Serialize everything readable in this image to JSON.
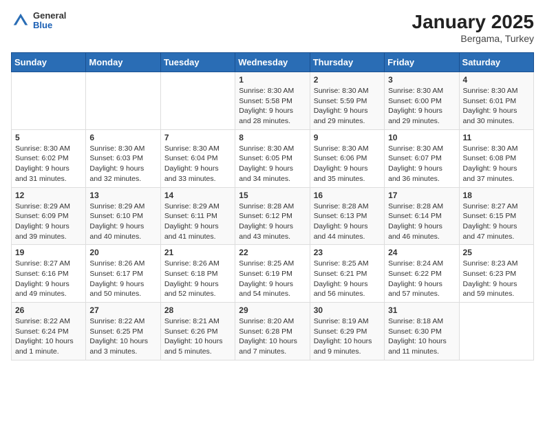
{
  "logo": {
    "general": "General",
    "blue": "Blue"
  },
  "title": "January 2025",
  "subtitle": "Bergama, Turkey",
  "weekdays": [
    "Sunday",
    "Monday",
    "Tuesday",
    "Wednesday",
    "Thursday",
    "Friday",
    "Saturday"
  ],
  "weeks": [
    [
      {
        "day": "",
        "info": ""
      },
      {
        "day": "",
        "info": ""
      },
      {
        "day": "",
        "info": ""
      },
      {
        "day": "1",
        "info": "Sunrise: 8:30 AM\nSunset: 5:58 PM\nDaylight: 9 hours and 28 minutes."
      },
      {
        "day": "2",
        "info": "Sunrise: 8:30 AM\nSunset: 5:59 PM\nDaylight: 9 hours and 29 minutes."
      },
      {
        "day": "3",
        "info": "Sunrise: 8:30 AM\nSunset: 6:00 PM\nDaylight: 9 hours and 29 minutes."
      },
      {
        "day": "4",
        "info": "Sunrise: 8:30 AM\nSunset: 6:01 PM\nDaylight: 9 hours and 30 minutes."
      }
    ],
    [
      {
        "day": "5",
        "info": "Sunrise: 8:30 AM\nSunset: 6:02 PM\nDaylight: 9 hours and 31 minutes."
      },
      {
        "day": "6",
        "info": "Sunrise: 8:30 AM\nSunset: 6:03 PM\nDaylight: 9 hours and 32 minutes."
      },
      {
        "day": "7",
        "info": "Sunrise: 8:30 AM\nSunset: 6:04 PM\nDaylight: 9 hours and 33 minutes."
      },
      {
        "day": "8",
        "info": "Sunrise: 8:30 AM\nSunset: 6:05 PM\nDaylight: 9 hours and 34 minutes."
      },
      {
        "day": "9",
        "info": "Sunrise: 8:30 AM\nSunset: 6:06 PM\nDaylight: 9 hours and 35 minutes."
      },
      {
        "day": "10",
        "info": "Sunrise: 8:30 AM\nSunset: 6:07 PM\nDaylight: 9 hours and 36 minutes."
      },
      {
        "day": "11",
        "info": "Sunrise: 8:30 AM\nSunset: 6:08 PM\nDaylight: 9 hours and 37 minutes."
      }
    ],
    [
      {
        "day": "12",
        "info": "Sunrise: 8:29 AM\nSunset: 6:09 PM\nDaylight: 9 hours and 39 minutes."
      },
      {
        "day": "13",
        "info": "Sunrise: 8:29 AM\nSunset: 6:10 PM\nDaylight: 9 hours and 40 minutes."
      },
      {
        "day": "14",
        "info": "Sunrise: 8:29 AM\nSunset: 6:11 PM\nDaylight: 9 hours and 41 minutes."
      },
      {
        "day": "15",
        "info": "Sunrise: 8:28 AM\nSunset: 6:12 PM\nDaylight: 9 hours and 43 minutes."
      },
      {
        "day": "16",
        "info": "Sunrise: 8:28 AM\nSunset: 6:13 PM\nDaylight: 9 hours and 44 minutes."
      },
      {
        "day": "17",
        "info": "Sunrise: 8:28 AM\nSunset: 6:14 PM\nDaylight: 9 hours and 46 minutes."
      },
      {
        "day": "18",
        "info": "Sunrise: 8:27 AM\nSunset: 6:15 PM\nDaylight: 9 hours and 47 minutes."
      }
    ],
    [
      {
        "day": "19",
        "info": "Sunrise: 8:27 AM\nSunset: 6:16 PM\nDaylight: 9 hours and 49 minutes."
      },
      {
        "day": "20",
        "info": "Sunrise: 8:26 AM\nSunset: 6:17 PM\nDaylight: 9 hours and 50 minutes."
      },
      {
        "day": "21",
        "info": "Sunrise: 8:26 AM\nSunset: 6:18 PM\nDaylight: 9 hours and 52 minutes."
      },
      {
        "day": "22",
        "info": "Sunrise: 8:25 AM\nSunset: 6:19 PM\nDaylight: 9 hours and 54 minutes."
      },
      {
        "day": "23",
        "info": "Sunrise: 8:25 AM\nSunset: 6:21 PM\nDaylight: 9 hours and 56 minutes."
      },
      {
        "day": "24",
        "info": "Sunrise: 8:24 AM\nSunset: 6:22 PM\nDaylight: 9 hours and 57 minutes."
      },
      {
        "day": "25",
        "info": "Sunrise: 8:23 AM\nSunset: 6:23 PM\nDaylight: 9 hours and 59 minutes."
      }
    ],
    [
      {
        "day": "26",
        "info": "Sunrise: 8:22 AM\nSunset: 6:24 PM\nDaylight: 10 hours and 1 minute."
      },
      {
        "day": "27",
        "info": "Sunrise: 8:22 AM\nSunset: 6:25 PM\nDaylight: 10 hours and 3 minutes."
      },
      {
        "day": "28",
        "info": "Sunrise: 8:21 AM\nSunset: 6:26 PM\nDaylight: 10 hours and 5 minutes."
      },
      {
        "day": "29",
        "info": "Sunrise: 8:20 AM\nSunset: 6:28 PM\nDaylight: 10 hours and 7 minutes."
      },
      {
        "day": "30",
        "info": "Sunrise: 8:19 AM\nSunset: 6:29 PM\nDaylight: 10 hours and 9 minutes."
      },
      {
        "day": "31",
        "info": "Sunrise: 8:18 AM\nSunset: 6:30 PM\nDaylight: 10 hours and 11 minutes."
      },
      {
        "day": "",
        "info": ""
      }
    ]
  ]
}
